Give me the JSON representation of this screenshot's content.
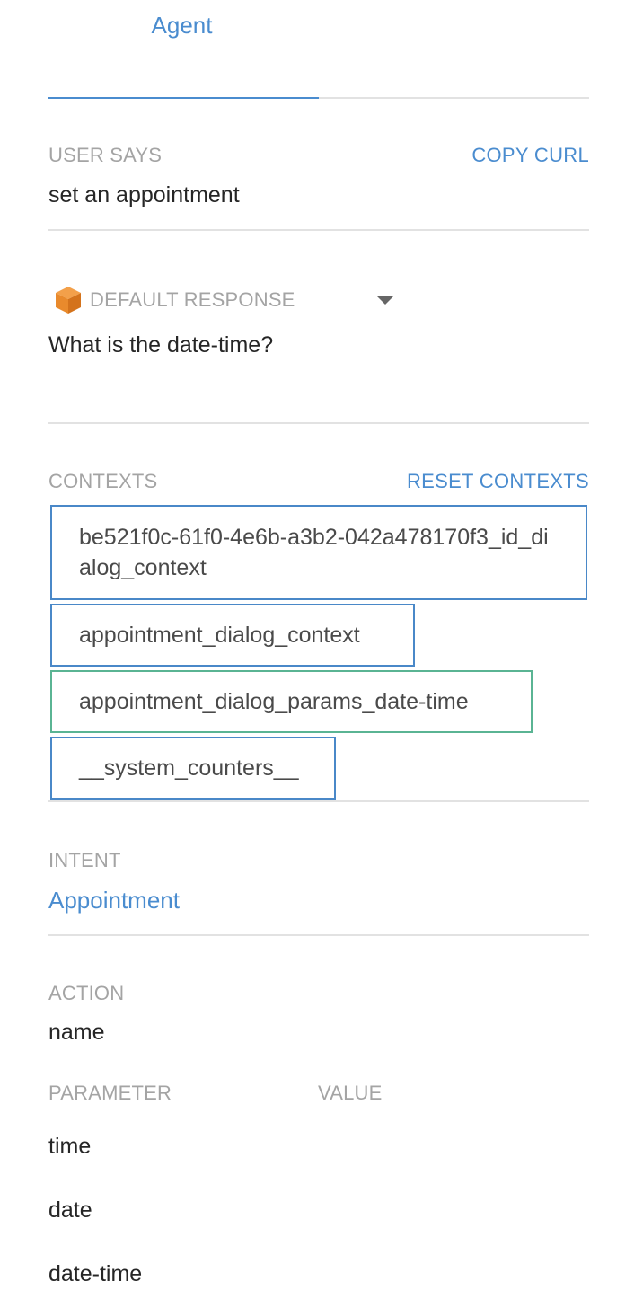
{
  "tabs": [
    {
      "label": "Agent",
      "active": true
    }
  ],
  "user_says": {
    "label": "USER SAYS",
    "copy_curl_label": "COPY CURL",
    "value": "set an appointment"
  },
  "default_response": {
    "icon": "box-icon",
    "label": "DEFAULT RESPONSE",
    "value": "What is the date-time?"
  },
  "contexts": {
    "label": "CONTEXTS",
    "reset_label": "RESET CONTEXTS",
    "items": [
      {
        "name": "be521f0c-61f0-4e6b-a3b2-042a478170f3_id_dialog_context",
        "color": "#4a88c8"
      },
      {
        "name": "appointment_dialog_context",
        "color": "#4a88c8"
      },
      {
        "name": "appointment_dialog_params_date-time",
        "color": "#5ab493"
      },
      {
        "name": "__system_counters__",
        "color": "#4a88c8"
      }
    ]
  },
  "intent": {
    "label": "INTENT",
    "value": "Appointment"
  },
  "action": {
    "label": "ACTION",
    "value": "name"
  },
  "parameters": {
    "param_header": "PARAMETER",
    "value_header": "VALUE",
    "rows": [
      {
        "name": "time",
        "value": ""
      },
      {
        "name": "date",
        "value": ""
      },
      {
        "name": "date-time",
        "value": ""
      }
    ]
  },
  "colors": {
    "accent": "#4a8ccf",
    "context_border": "#4a88c8",
    "context_active_border": "#5ab493",
    "icon_orange": "#e98a2c"
  }
}
